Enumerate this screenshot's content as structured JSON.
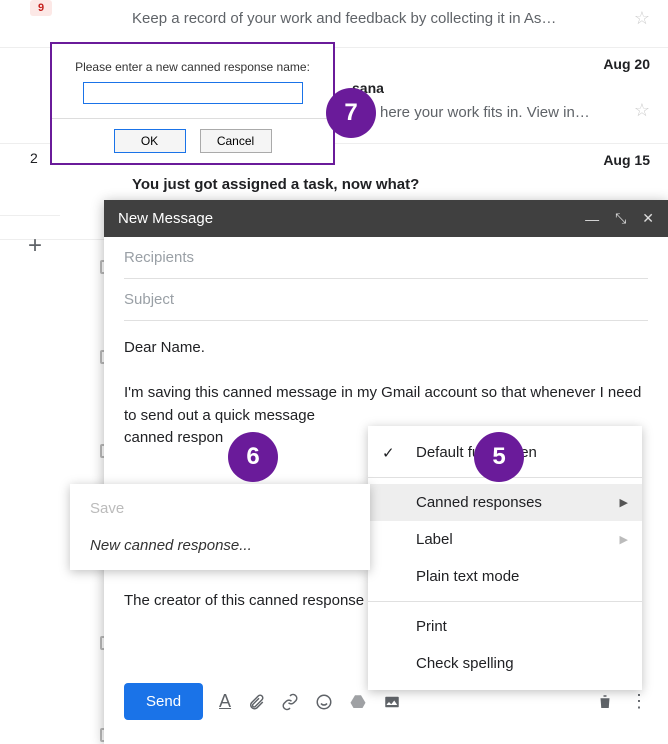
{
  "badge_red": "9",
  "unread_num": "2",
  "mail_rows": [
    {
      "snippet": "Keep a record of your work and feedback by collecting it in As…",
      "date": ""
    },
    {
      "sender": "sana",
      "snippet": "here your work fits in. View in…",
      "date": "Aug 20"
    },
    {
      "title": "You just got assigned a task, now what?",
      "date": "Aug 15"
    }
  ],
  "compose": {
    "title": "New Message",
    "recipients": "Recipients",
    "subject": "Subject",
    "body_line1": "Dear Name.",
    "body_line2": "I'm saving this canned message in my Gmail account so that whenever I need to send out a quick message",
    "body_line3": "canned respon",
    "body_line4": "The creator of this canned response",
    "send": "Send"
  },
  "menu": {
    "fullscreen": "Default full-screen",
    "canned": "Canned responses",
    "label": "Label",
    "plaintext": "Plain text mode",
    "print": "Print",
    "spelling": "Check spelling"
  },
  "submenu": {
    "save": "Save",
    "new_canned": "New canned response..."
  },
  "prompt": {
    "msg": "Please enter a new canned response name:",
    "ok": "OK",
    "cancel": "Cancel"
  },
  "steps": {
    "s5": "5",
    "s6": "6",
    "s7": "7"
  }
}
